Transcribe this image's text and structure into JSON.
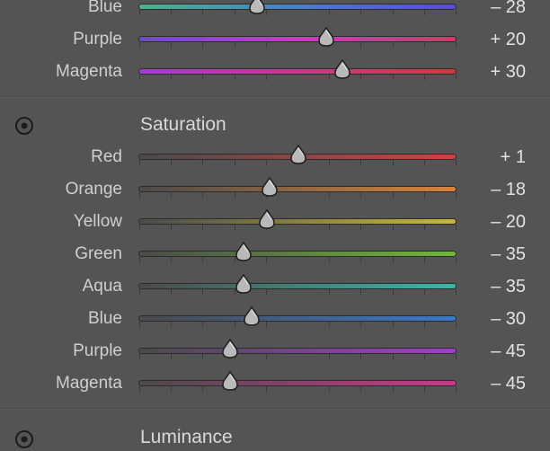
{
  "hue_rows": [
    {
      "label": "Blue",
      "value": "– 28",
      "pos": 0.372,
      "track": [
        "#4bb28c",
        "#4a7ec8",
        "#5b4bd6"
      ]
    },
    {
      "label": "Purple",
      "value": "+ 20",
      "pos": 0.59,
      "track": [
        "#6a4bd6",
        "#c43fc0",
        "#d13a64"
      ]
    },
    {
      "label": "Magenta",
      "value": "+ 30",
      "pos": 0.641,
      "track": [
        "#a43ed0",
        "#c73a90",
        "#cf3a3a"
      ]
    }
  ],
  "saturation": {
    "title": "Saturation",
    "rows": [
      {
        "label": "Red",
        "value": "+ 1",
        "pos": 0.502,
        "track": [
          "#4a4a4a",
          "#d14040"
        ]
      },
      {
        "label": "Orange",
        "value": "– 18",
        "pos": 0.413,
        "track": [
          "#4a4a4a",
          "#d8843a"
        ]
      },
      {
        "label": "Yellow",
        "value": "– 20",
        "pos": 0.404,
        "track": [
          "#4a4a4a",
          "#c8b83a"
        ]
      },
      {
        "label": "Green",
        "value": "– 35",
        "pos": 0.33,
        "track": [
          "#4a4a4a",
          "#6fb83a"
        ]
      },
      {
        "label": "Aqua",
        "value": "– 35",
        "pos": 0.33,
        "track": [
          "#4a4a4a",
          "#3ab8a8"
        ]
      },
      {
        "label": "Blue",
        "value": "– 30",
        "pos": 0.356,
        "track": [
          "#4a4a4a",
          "#3a78c8"
        ]
      },
      {
        "label": "Purple",
        "value": "– 45",
        "pos": 0.287,
        "track": [
          "#4a4a4a",
          "#a03ec8"
        ]
      },
      {
        "label": "Magenta",
        "value": "– 45",
        "pos": 0.287,
        "track": [
          "#4a4a4a",
          "#c83a8a"
        ]
      }
    ]
  },
  "luminance": {
    "title": "Luminance"
  },
  "icons": {
    "target": "target-adjustment-icon",
    "thumb": "slider-thumb-icon"
  },
  "colors": {
    "panel_bg": "#545454",
    "thumb_fill": "#b9b9b9",
    "thumb_border": "#1e1e1e"
  }
}
